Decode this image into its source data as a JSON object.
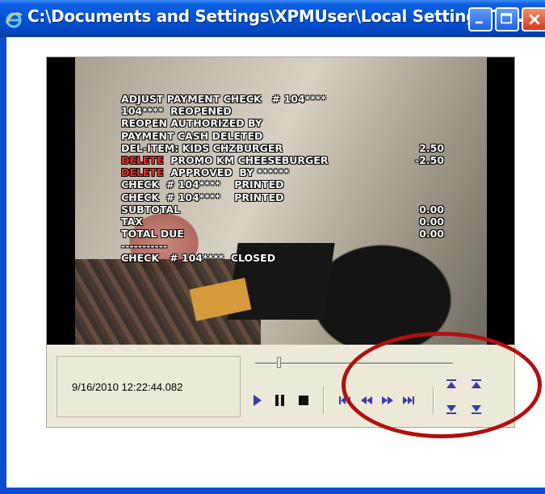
{
  "window": {
    "title": "C:\\Documents and Settings\\XPMUser\\Local Settings\\Te...",
    "title_icon": "ie-icon",
    "buttons": [
      "minimize-icon",
      "maximize-icon",
      "close-icon"
    ]
  },
  "video": {
    "osd": {
      "lines": [
        {
          "text": "ADJUST PAYMENT CHECK   # 104****",
          "amount": ""
        },
        {
          "text": "104****  REOPENED",
          "amount": ""
        },
        {
          "text": "REOPEN AUTHORIZED BY",
          "amount": ""
        },
        {
          "text": "PAYMENT CASH DELETED",
          "amount": ""
        },
        {
          "text": "DEL-ITEM: KIDS CHZBURGER",
          "amount": "2.50"
        },
        {
          "prefix": "DELETE",
          "text": "  PROMO KM CHEESEBURGER",
          "amount": "-2.50"
        },
        {
          "prefix": "DELETE",
          "text": "  APPROVED  BY ******",
          "amount": ""
        },
        {
          "text": "CHECK  # 104****    PRINTED",
          "amount": ""
        },
        {
          "text": "CHECK  # 104****    PRINTED",
          "amount": ""
        },
        {
          "text": "SUBTOTAL",
          "amount": "0.00"
        },
        {
          "text": "TAX",
          "amount": "0.00"
        },
        {
          "text": "TOTAL DUE",
          "amount": "0.00"
        },
        {
          "text": "-----------",
          "amount": ""
        },
        {
          "text": "CHECK   # 104****  CLOSED",
          "amount": ""
        }
      ]
    }
  },
  "controls": {
    "timestamp": "9/16/2010 12:22:44.082",
    "seek_position": 0.12,
    "playback_buttons": [
      "play-icon",
      "pause-icon",
      "stop-icon"
    ],
    "navigation_buttons": [
      "skip-to-start-icon",
      "rewind-icon",
      "fast-forward-icon",
      "skip-to-end-icon"
    ],
    "speed_buttons": [
      "speed-up-icon",
      "speed-up-icon",
      "speed-down-icon",
      "speed-down-icon"
    ]
  },
  "colors": {
    "icon": "#3a3aa8",
    "highlight_ring": "#b11010",
    "osd_delete": "#ff2a2a",
    "titlebar": "#0453d6"
  }
}
